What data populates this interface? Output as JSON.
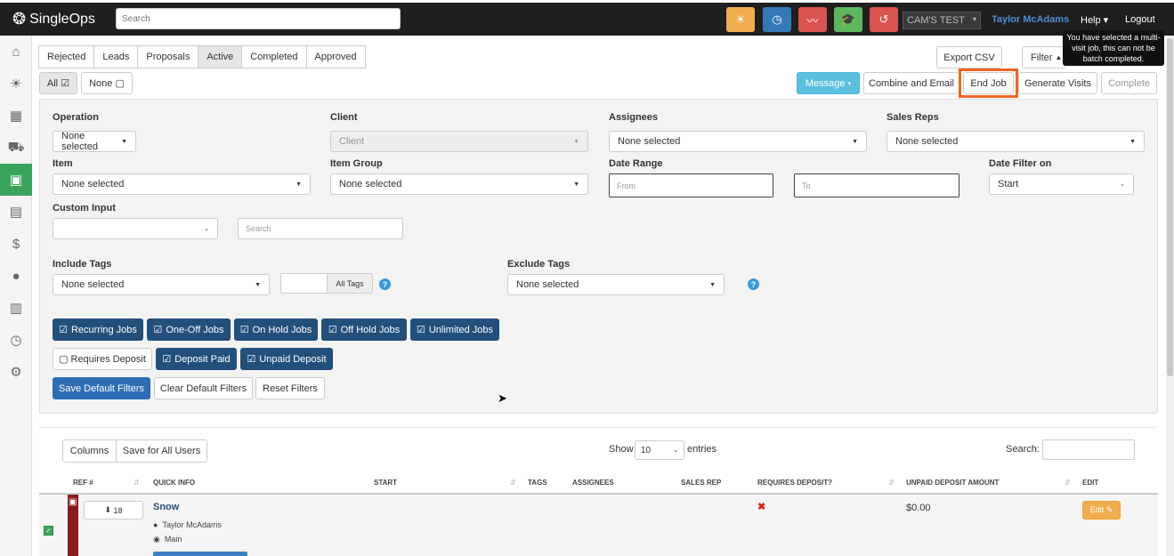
{
  "app": {
    "logo": "SingleOps"
  },
  "topbar": {
    "search_placeholder": "Search",
    "company": "CAM'S TEST",
    "user": "Taylor McAdams",
    "help": "Help ▾",
    "logout": "Logout",
    "icon_colors": [
      "#f0ad4e",
      "#337ab7",
      "#d9534f",
      "#5cb85c",
      "#d9534f"
    ]
  },
  "tabs": [
    "Rejected",
    "Leads",
    "Proposals",
    "Active",
    "Completed",
    "Approved"
  ],
  "select": {
    "all": "All",
    "none": "None"
  },
  "actions": {
    "export_csv": "Export CSV",
    "filter": "Filter",
    "message": "Message",
    "combine_email": "Combine and Email",
    "end_job": "End Job",
    "generate_visits": "Generate Visits",
    "complete": "Complete",
    "tooltip": "You have selected a multi-visit job, this can not be batch completed."
  },
  "filters": {
    "operation": {
      "label": "Operation",
      "value": "None selected"
    },
    "client": {
      "label": "Client",
      "placeholder": "Client"
    },
    "assignees": {
      "label": "Assignees",
      "value": "None selected"
    },
    "sales_reps": {
      "label": "Sales Reps",
      "value": "None selected"
    },
    "item": {
      "label": "Item",
      "value": "None selected"
    },
    "item_group": {
      "label": "Item Group",
      "value": "None selected"
    },
    "date_range": {
      "label": "Date Range",
      "from": "From",
      "to": "To"
    },
    "date_filter_on": {
      "label": "Date Filter on",
      "value": "Start"
    },
    "custom_input": {
      "label": "Custom Input",
      "value": "",
      "search_placeholder": "Search"
    },
    "include_tags": {
      "label": "Include Tags",
      "value": "None selected",
      "all_tags": "All Tags"
    },
    "exclude_tags": {
      "label": "Exclude Tags",
      "value": "None selected"
    },
    "job_types": [
      "Recurring Jobs",
      "One-Off Jobs",
      "On Hold Jobs",
      "Off Hold Jobs",
      "Unlimited Jobs"
    ],
    "deposit": {
      "requires": "Requires Deposit",
      "paid": "Deposit Paid",
      "unpaid": "Unpaid Deposit"
    },
    "save_default": "Save Default Filters",
    "clear_default": "Clear Default Filters",
    "reset": "Reset Filters"
  },
  "table": {
    "columns_btn": "Columns",
    "save_users_btn": "Save for All Users",
    "show_label": "Show",
    "entries_value": "10",
    "entries_label": "entries",
    "search_label": "Search:",
    "headers": [
      "REF #",
      "QUICK INFO",
      "START",
      "TAGS",
      "ASSIGNEES",
      "SALES REP",
      "REQUIRES DEPOSIT?",
      "UNPAID DEPOSIT AMOUNT",
      "EDIT"
    ],
    "row": {
      "ref": "18",
      "title": "Snow",
      "person": "Taylor McAdams",
      "location": "Main",
      "requires_deposit": "✖",
      "amount": "$0.00",
      "edit": "Edit ✎"
    }
  }
}
